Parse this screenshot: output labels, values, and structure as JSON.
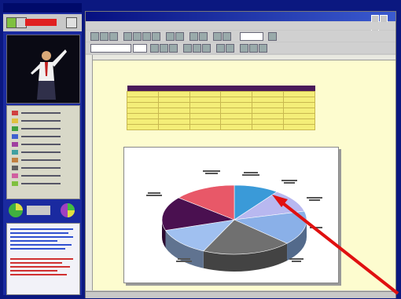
{
  "left_panel": {
    "title": "",
    "legend_colors": [
      "#d04040",
      "#e0c040",
      "#40a040",
      "#4060d0",
      "#a040a0",
      "#40a0a0",
      "#c08040",
      "#606060",
      "#d060a0",
      "#80c040"
    ]
  },
  "main_window": {
    "title": "",
    "menu": []
  },
  "document": {
    "heading": "",
    "table_header": [
      "",
      "",
      "",
      "",
      "",
      ""
    ],
    "table_rows": [
      [
        "",
        "",
        "",
        "",
        "",
        ""
      ],
      [
        "",
        "",
        "",
        "",
        "",
        ""
      ],
      [
        "",
        "",
        "",
        "",
        "",
        ""
      ],
      [
        "",
        "",
        "",
        "",
        "",
        ""
      ],
      [
        "",
        "",
        "",
        "",
        "",
        ""
      ],
      [
        "",
        "",
        "",
        "",
        "",
        ""
      ],
      [
        "",
        "",
        "",
        "",
        "",
        ""
      ]
    ]
  },
  "chart": {
    "title": "",
    "colors": [
      "#3a9ad8",
      "#b8b8f0",
      "#8ab0e8",
      "#707070",
      "#a0c0f0",
      "#4a1050",
      "#e85868"
    ]
  },
  "annotation": {
    "arrow_color": "#e01010"
  }
}
